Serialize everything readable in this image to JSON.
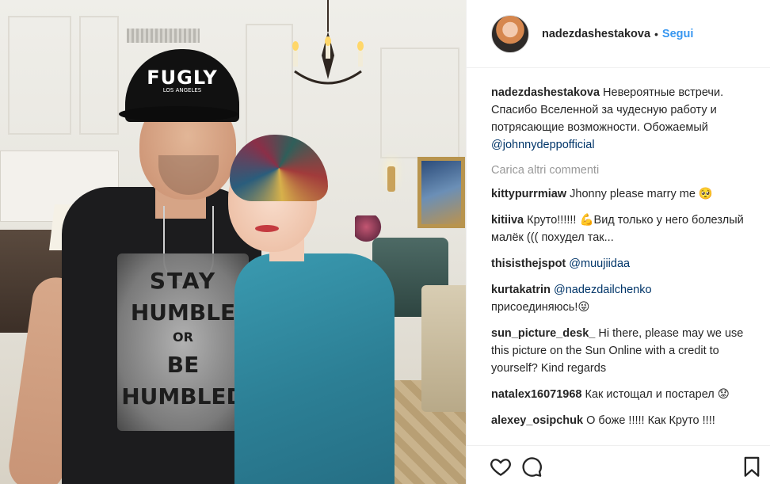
{
  "photo": {
    "cap_text": "FUGLY",
    "cap_sub": "LOS ANGELES",
    "shirt_lines": [
      "STAY",
      "HUMBLE",
      "OR",
      "BE",
      "HUMBLED"
    ]
  },
  "header": {
    "username": "nadezdashestakova",
    "separator": "•",
    "follow_label": "Segui"
  },
  "caption": {
    "username": "nadezdashestakova",
    "text": "Невероятные встречи. Спасибо Вселенной за чудесную работу и потрясающие возможности. Обожаемый",
    "mention": "@johnnydeppofficial"
  },
  "load_more_label": "Carica altri commenti",
  "comments": [
    {
      "username": "kittypurrmiaw",
      "text": "Jhonny please marry me 🥺",
      "mention": ""
    },
    {
      "username": "kitiiva",
      "text": "Круто!!!!!! 💪Вид только у него болезлый малёк ((( похудел так...",
      "mention": ""
    },
    {
      "username": "thisisthejspot",
      "text": "",
      "mention": "@muujiidaa"
    },
    {
      "username": "kurtakatrin",
      "text": "присоединяюсь!😜",
      "mention": "@nadezdailchenko"
    },
    {
      "username": "sun_picture_desk_",
      "text": "Hi there, please may we use this picture on the Sun Online with a credit to yourself? Kind regards",
      "mention": ""
    },
    {
      "username": "natalex16071968",
      "text": "Как истощал и постарел 😟",
      "mention": ""
    },
    {
      "username": "alexey_osipchuk",
      "text": "О боже !!!!! Как Круто !!!!",
      "mention": ""
    }
  ],
  "actions": {
    "icons": [
      "heart-icon",
      "comment-icon",
      "bookmark-icon"
    ]
  },
  "colors": {
    "link": "#003569",
    "follow": "#3897f0",
    "muted": "#999999",
    "dress": "#2c7f95"
  }
}
